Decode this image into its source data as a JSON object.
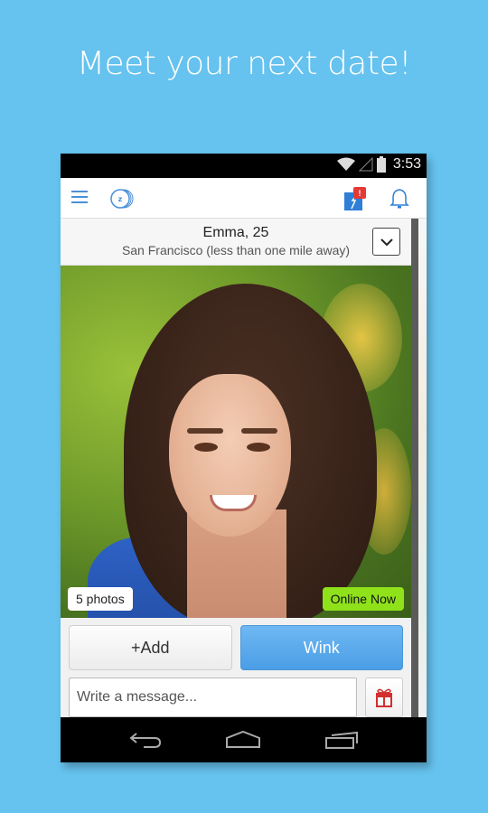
{
  "headline": "Meet your next date!",
  "status_bar": {
    "time": "3:53",
    "icons": [
      "wifi-icon",
      "signal-icon",
      "battery-icon"
    ]
  },
  "app_bar": {
    "icons": [
      "menu-icon",
      "app-logo-icon",
      "notification-flash-icon",
      "bell-icon"
    ],
    "notification_badge": "!",
    "accent_color": "#4a90d9",
    "badge_color": "#e53935"
  },
  "profile": {
    "name_age": "Emma, 25",
    "location": "San Francisco (less than one mile away)",
    "photos_label": "5 photos",
    "online_label": "Online Now",
    "online_color": "#8fe21a"
  },
  "actions": {
    "add_label": "+Add",
    "wink_label": "Wink",
    "wink_color": "#4a9ee6"
  },
  "message": {
    "placeholder": "Write a message...",
    "gift_icon": "gift-icon"
  },
  "nav_bar": {
    "buttons": [
      "back-icon",
      "home-icon",
      "recent-apps-icon"
    ]
  }
}
